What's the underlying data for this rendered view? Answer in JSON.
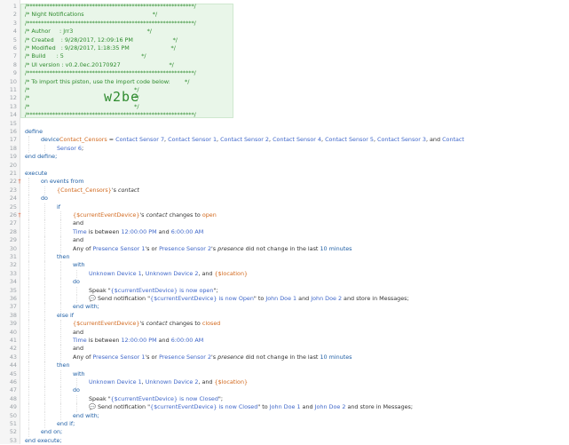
{
  "import_code": "w2be",
  "header": {
    "stars": "/***********************************************************/",
    "title": "/* Night Notifications                                      */",
    "author": "/* Author     : Jrr3                                         */",
    "created": "/* Created    : 9/28/2017, 12:09:16 PM                      */",
    "modified": "/* Modified   : 9/28/2017, 1:18:35 PM                       */",
    "build": "/* Build      : 5                                           */",
    "ui_version": "/* UI version : v0.2.0ec.20170927                           */",
    "import_hint": "/* To import this piston, use the import code below:        */",
    "blank": "/*                                                          */"
  },
  "lines": {
    "l16": "define",
    "l17a": "device",
    "l17b": "Contact_Censors",
    "l17c": " = ",
    "l17d": "Contact Sensor 7",
    "l17e": ", ",
    "l17f": "Contact Sensor 1",
    "l17g": ", ",
    "l17h": "Contact Sensor 2",
    "l17i": ", ",
    "l17j": "Contact Sensor 4",
    "l17k": ", ",
    "l17l": "Contact Sensor 5",
    "l17m": ", ",
    "l17n": "Contact Sensor 3",
    "l17o": ", and ",
    "l17p": "Contact",
    "l18a": "Sensor 6",
    "l18b": ";",
    "l19": "end define;",
    "l20": "execute",
    "l21": "on events from",
    "l22a": "{Contact_Censors}",
    "l22b": "'s ",
    "l22c": "contact",
    "l23": "do",
    "l24": "if",
    "l25a": "{$currentEventDevice}",
    "l25b": "'s ",
    "l25c": "contact",
    "l25d": " changes to ",
    "l25e": "open",
    "and": "and",
    "l27a": "Time",
    "l27b": " is between ",
    "l27c": "12:00:00 PM",
    "l27d": " and ",
    "l27e": "6:00:00 AM",
    "l29a": "Any of ",
    "l29b": "Presence Sensor 1",
    "l29c": "'s or ",
    "l29d": "Presence Sensor 2",
    "l29e": "'s ",
    "l29f": "presence",
    "l29g": " did not change in the last ",
    "l29h": "10 minutes",
    "then": "then",
    "with": "with",
    "l32a": "Unknown Device 1",
    "l32b": ", ",
    "l32c": "Unknown Device 2",
    "l32d": ", and ",
    "l32e": "{$location}",
    "do": "do",
    "l34a": "Speak \"",
    "l34b": "{$currentEventDevice} is now open",
    "l34c": "\";",
    "l35a": "💬 Send notification \"",
    "l35b": "{$currentEventDevice} is now Open",
    "l35c": "\" to ",
    "l35d": "John Doe 1",
    "l35e": " and ",
    "l35f": "John Doe 2",
    "l35g": " and store in Messages;",
    "end_with": "end with;",
    "else_if": "else if",
    "l38e": "closed",
    "l46a": "Speak \"",
    "l46b": "{$currentEventDevice} is now Closed",
    "l46c": "\";",
    "l47b": "{$currentEventDevice} is now Closed",
    "end_if": "end if;",
    "end_on": "end on;",
    "end_execute": "end execute;"
  }
}
